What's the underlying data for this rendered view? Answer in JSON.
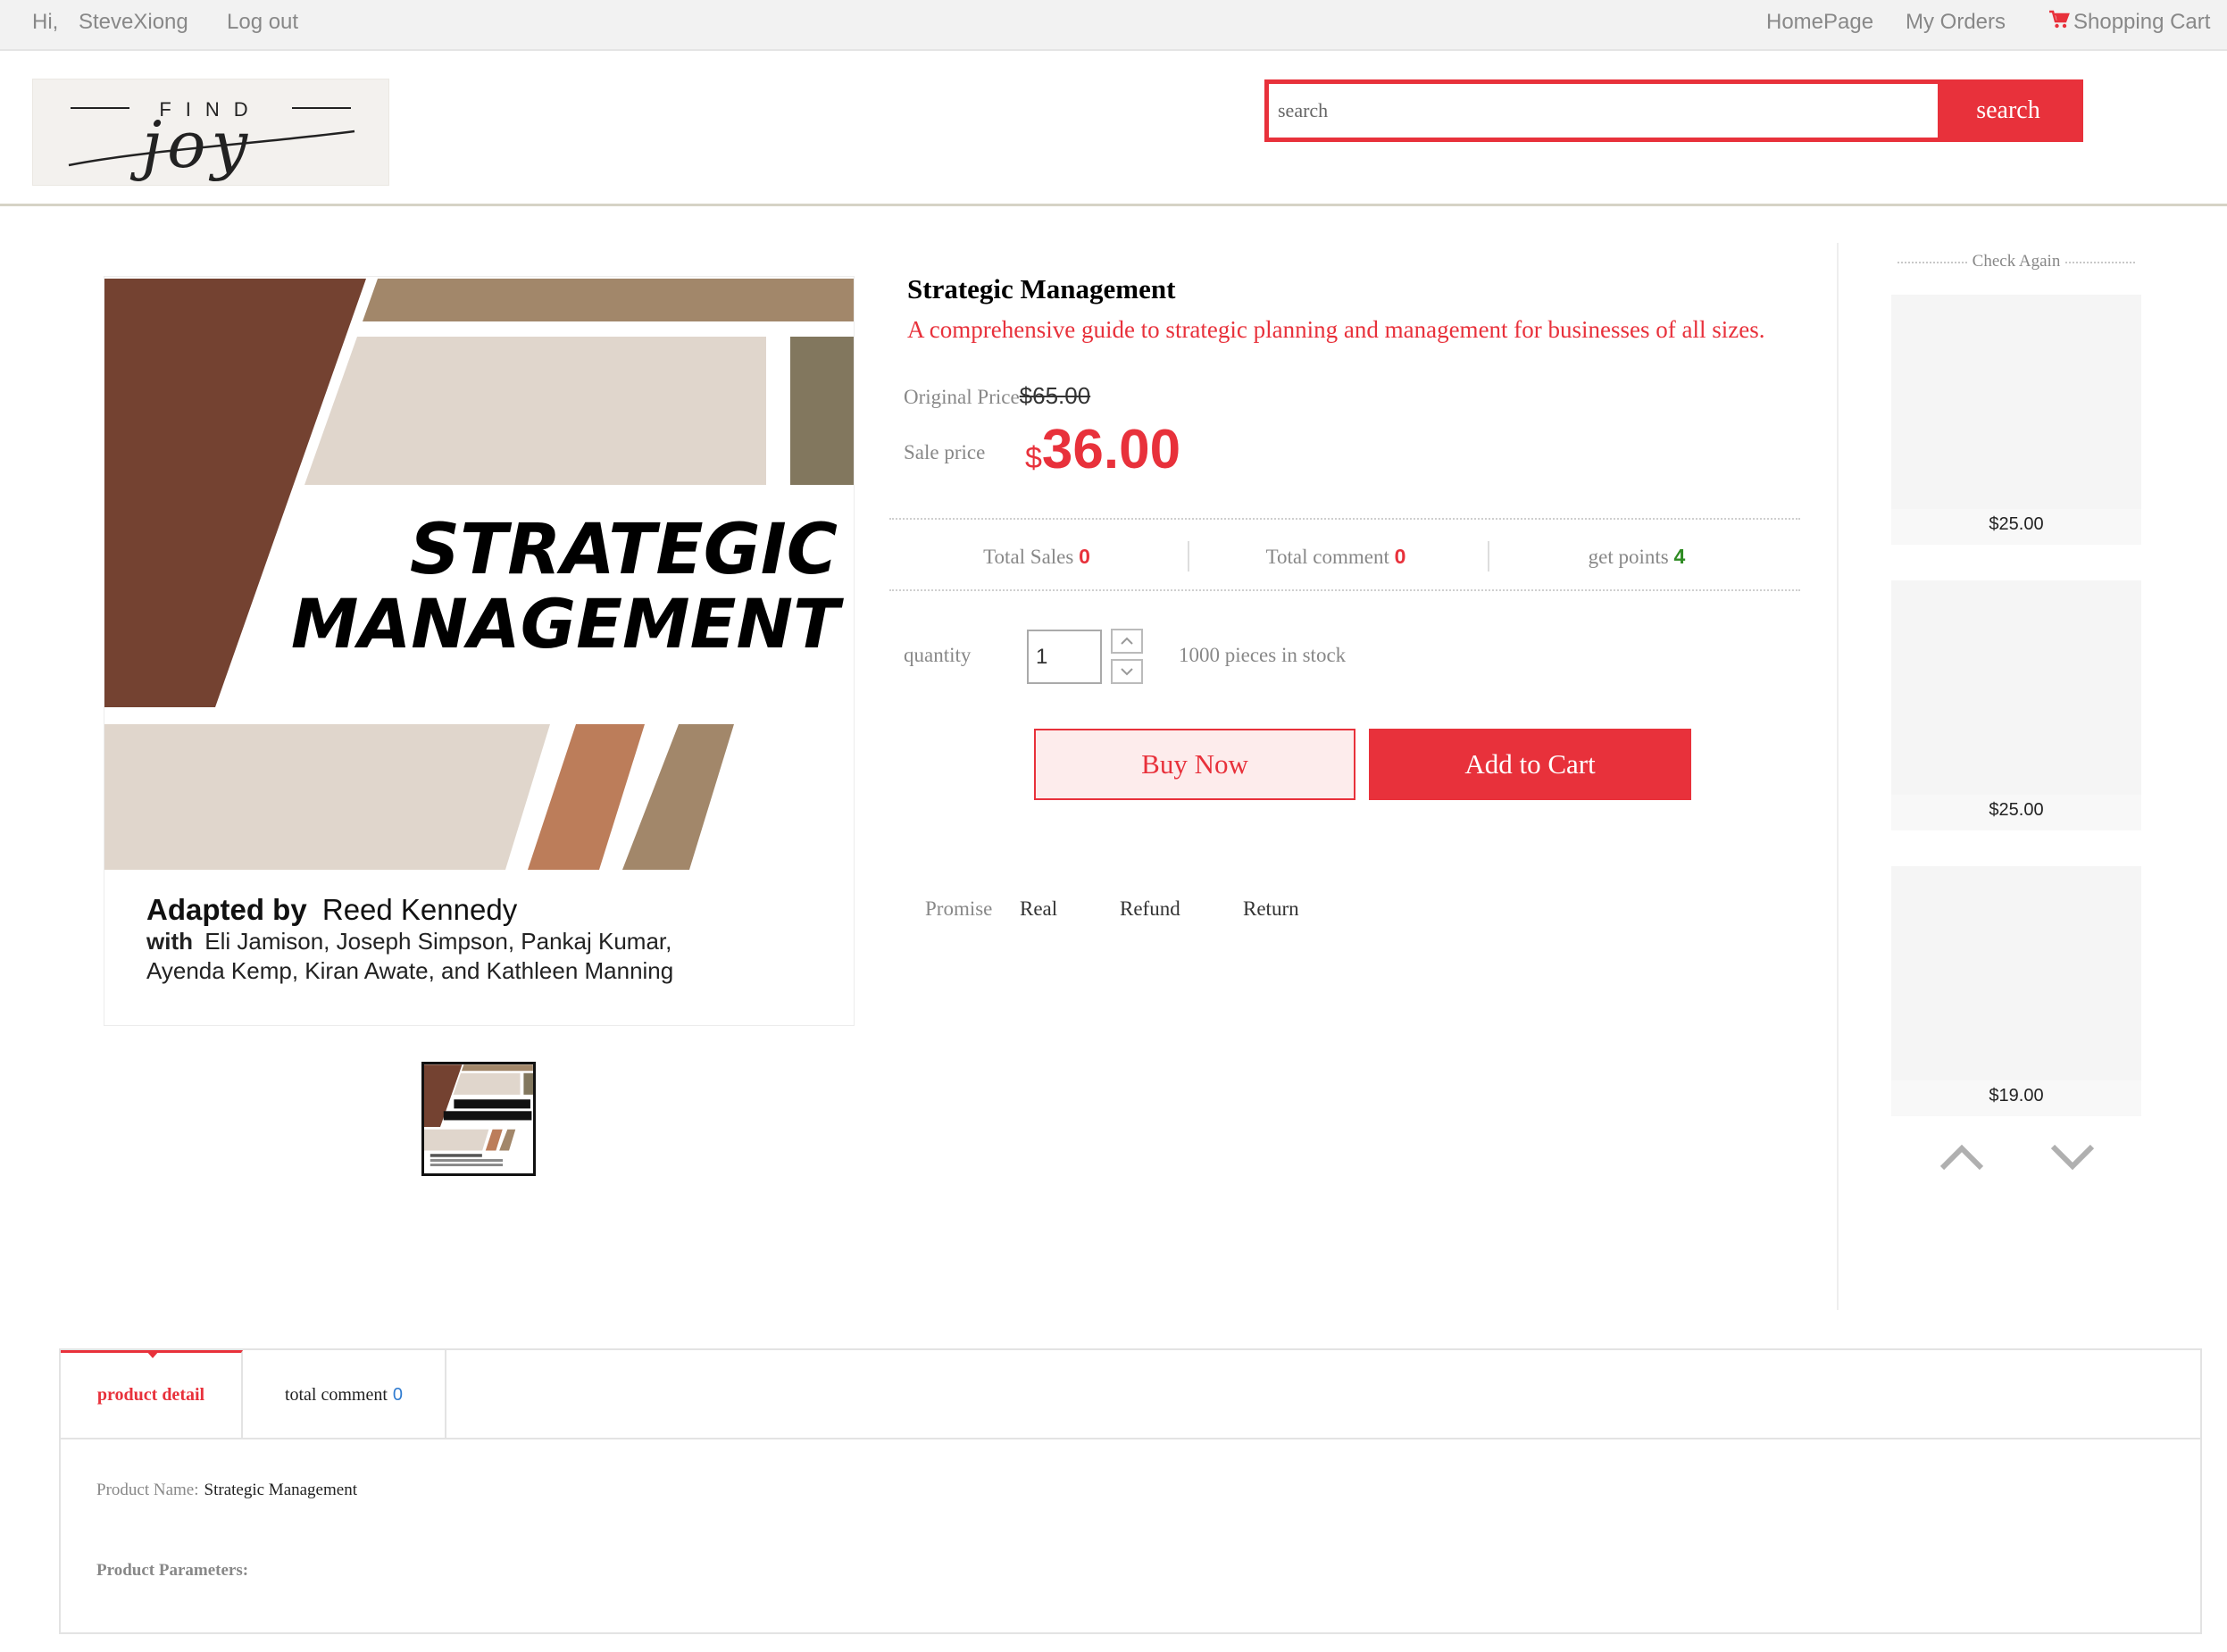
{
  "topbar": {
    "greeting": "Hi,",
    "username": "SteveXiong",
    "logout": "Log out",
    "homepage": "HomePage",
    "my_orders": "My Orders",
    "shopping_cart": "Shopping Cart",
    "cart_icon": "shopping-cart-icon"
  },
  "logo": {
    "text_top": "FIND",
    "text_script": "joy"
  },
  "search": {
    "placeholder": "search",
    "button_label": "search"
  },
  "product": {
    "title": "Strategic Management",
    "subtitle": "A comprehensive guide to strategic planning and management for businesses of all sizes.",
    "original_price_label": "Original Price",
    "original_price": "$65.00",
    "sale_price_label": "Sale price",
    "sale_currency": "$",
    "sale_price": "36.00",
    "cover": {
      "title_line1": "STRATEGIC",
      "title_line2": "MANAGEMENT",
      "adapted_by_label": "Adapted by",
      "adapted_by_name": "Reed Kennedy",
      "with_label": "with",
      "with_names_1": "Eli Jamison, Joseph Simpson, Pankaj Kumar,",
      "with_names_2": "Ayenda Kemp, Kiran Awate, and Kathleen Manning"
    }
  },
  "stats": {
    "total_sales_label": "Total Sales",
    "total_sales": "0",
    "total_comment_label": "Total comment",
    "total_comment": "0",
    "points_label": "get points",
    "points": "4"
  },
  "quantity": {
    "label": "quantity",
    "value": "1",
    "stock_text": "1000 pieces in stock"
  },
  "actions": {
    "buy_now": "Buy Now",
    "add_to_cart": "Add to Cart"
  },
  "promise": {
    "label": "Promise",
    "items": [
      "Real",
      "Refund",
      "Return"
    ]
  },
  "check_again": {
    "title": "Check Again",
    "items": [
      {
        "price": "$25.00"
      },
      {
        "price": "$25.00"
      },
      {
        "price": "$19.00"
      }
    ],
    "up_icon": "chevron-up-icon",
    "down_icon": "chevron-down-icon"
  },
  "tabs": {
    "detail_label": "product detail",
    "comment_label": "total comment",
    "comment_count": "0",
    "product_name_label": "Product Name:",
    "product_name_value": "Strategic Management",
    "product_params_label": "Product Parameters:"
  },
  "colors": {
    "accent_red": "#e8313b",
    "points_green": "#2e8b22",
    "cover_dark_brown": "#744231",
    "cover_tan": "#a2876a",
    "cover_beige": "#e0d6cc",
    "cover_olive": "#82775e",
    "cover_copper": "#bc7d5a"
  }
}
